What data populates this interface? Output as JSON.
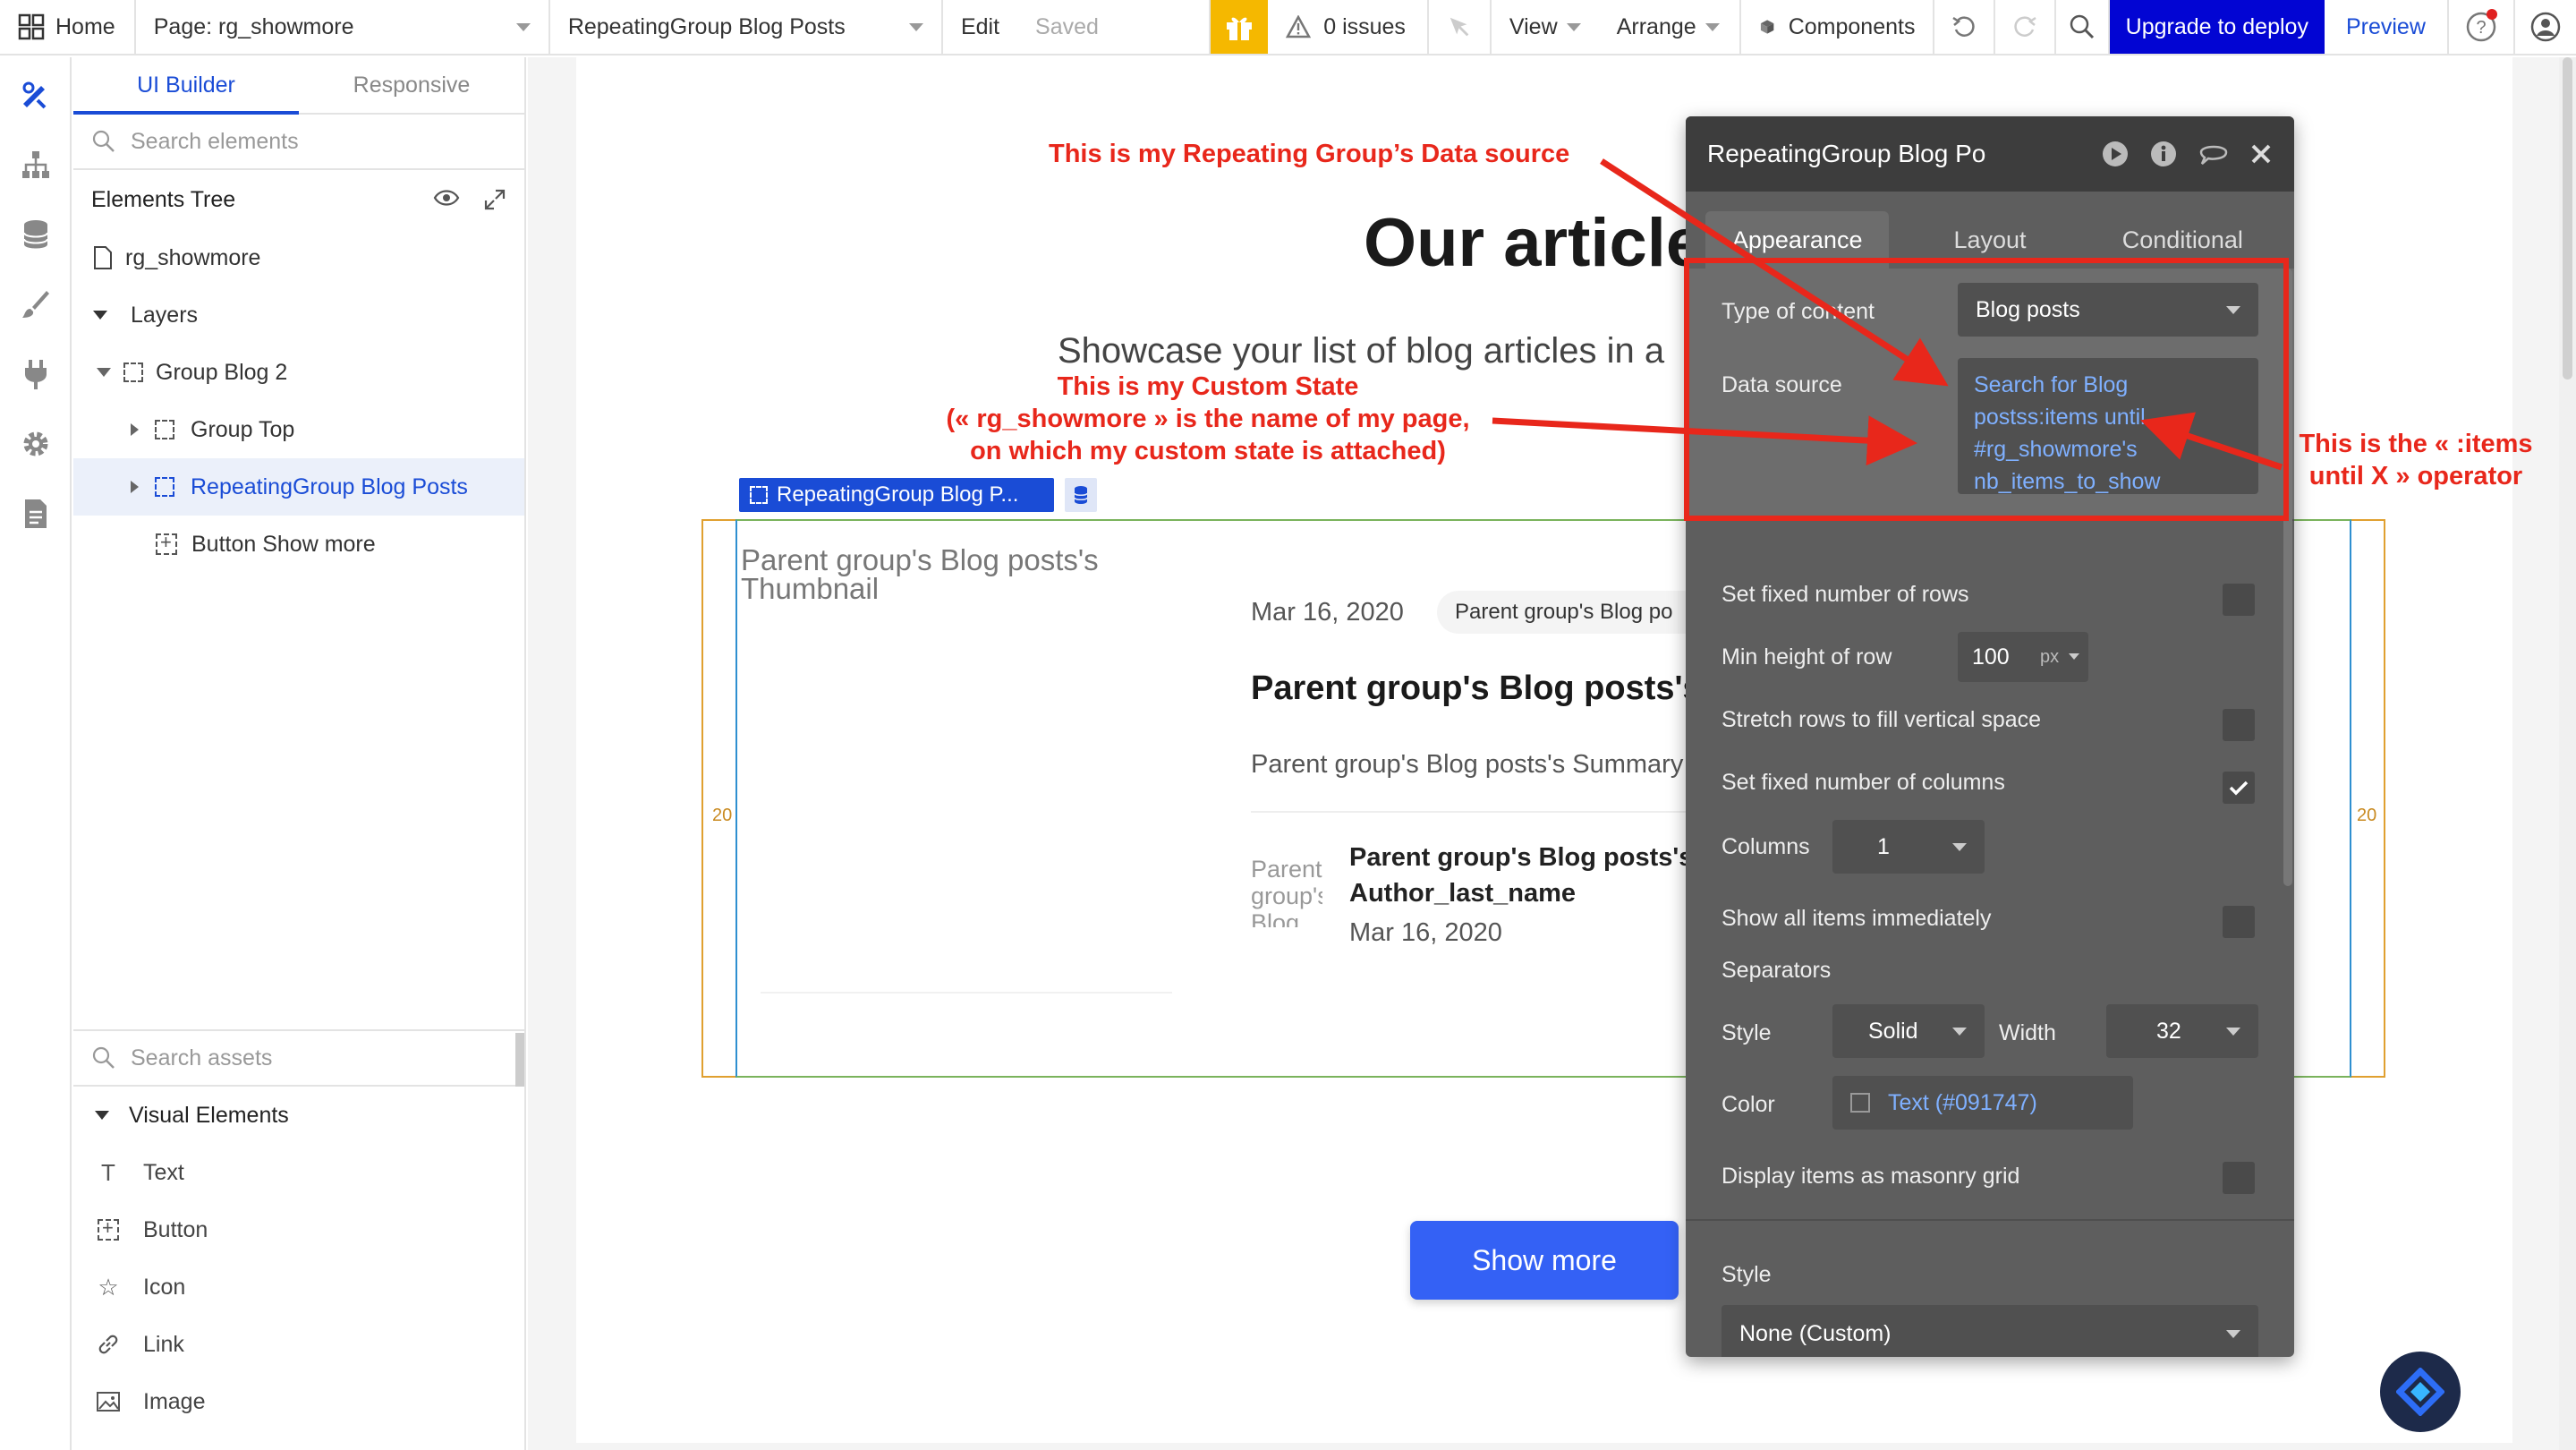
{
  "topbar": {
    "home_label": "Home",
    "page_label": "Page: rg_showmore",
    "element_label": "RepeatingGroup Blog Posts",
    "edit_label": "Edit",
    "saved_label": "Saved",
    "issues_label": "0 issues",
    "view_label": "View",
    "arrange_label": "Arrange",
    "components_label": "Components",
    "upgrade_label": "Upgrade to deploy",
    "preview_label": "Preview"
  },
  "panel": {
    "tabs": [
      {
        "label": "UI Builder",
        "active": true
      },
      {
        "label": "Responsive",
        "active": false
      }
    ],
    "search_placeholder": "Search elements",
    "tree_title": "Elements Tree",
    "tree": {
      "page": "rg_showmore",
      "layers": "Layers",
      "group_blog": "Group Blog 2",
      "group_top": "Group Top",
      "repeating_group": "RepeatingGroup Blog Posts",
      "button_show_more": "Button Show more"
    },
    "assets_placeholder": "Search assets",
    "visual_elements_title": "Visual Elements",
    "visual_elements": [
      "Text",
      "Button",
      "Icon",
      "Link",
      "Image"
    ]
  },
  "canvas": {
    "title": "Our article",
    "subtitle": "Showcase your list of blog articles in a",
    "rg_tag": "RepeatingGroup Blog P...",
    "margin_left": "20",
    "margin_right": "20",
    "thumbnail_text": "Parent group's Blog posts's Thumbnail",
    "card_date": "Mar 16, 2020",
    "card_chip": "Parent group's Blog po",
    "card_title": "Parent group's Blog posts's T",
    "card_summary": "Parent group's Blog posts's Summary",
    "author_avatar_text": "Parent group's Blog",
    "author_name_line1": "Parent group's Blog posts's",
    "author_name_line2": "Author_last_name",
    "author_date": "Mar 16, 2020",
    "show_more_label": "Show more"
  },
  "editor": {
    "title": "RepeatingGroup Blog Po",
    "tabs": [
      {
        "label": "Appearance",
        "active": true
      },
      {
        "label": "Layout",
        "active": false
      },
      {
        "label": "Conditional",
        "active": false
      }
    ],
    "type_of_content_label": "Type of content",
    "type_of_content_value": "Blog posts",
    "data_source_label": "Data source",
    "data_source_lines": [
      "Search for Blog",
      "postss:items until",
      "#rg_showmore's",
      "nb_items_to_show"
    ],
    "fixed_rows_label": "Set fixed number of rows",
    "fixed_rows_checked": false,
    "min_height_label": "Min height of row",
    "min_height_value": "100",
    "min_height_unit": "px",
    "stretch_rows_label": "Stretch rows to fill vertical space",
    "stretch_rows_checked": false,
    "fixed_columns_label": "Set fixed number of columns",
    "fixed_columns_checked": true,
    "columns_label": "Columns",
    "columns_value": "1",
    "show_all_label": "Show all items immediately",
    "show_all_checked": false,
    "separators_label": "Separators",
    "sep_style_label": "Style",
    "sep_style_value": "Solid",
    "sep_width_label": "Width",
    "sep_width_value": "32",
    "sep_color_label": "Color",
    "sep_color_value": "Text (#091747)",
    "masonry_label": "Display items as masonry grid",
    "masonry_checked": false,
    "style_label": "Style",
    "style_value": "None (Custom)"
  },
  "annotations": {
    "data_source_note": "This is my Repeating Group’s Data source",
    "custom_state_note_1": "This is my Custom State",
    "custom_state_note_2": "(« rg_showmore » is the name of my page,",
    "custom_state_note_3": "on which my custom state is attached)",
    "operator_note_1": "This is the « :items",
    "operator_note_2": "until X » operator"
  },
  "colors": {
    "accent": "#1a4cd6",
    "upgrade_bg": "#0205d3",
    "gift_bg": "#f5b800",
    "show_more_bg": "#3461f5",
    "annotation_red": "#e8271b",
    "editor_bg": "#5e5e5e"
  }
}
